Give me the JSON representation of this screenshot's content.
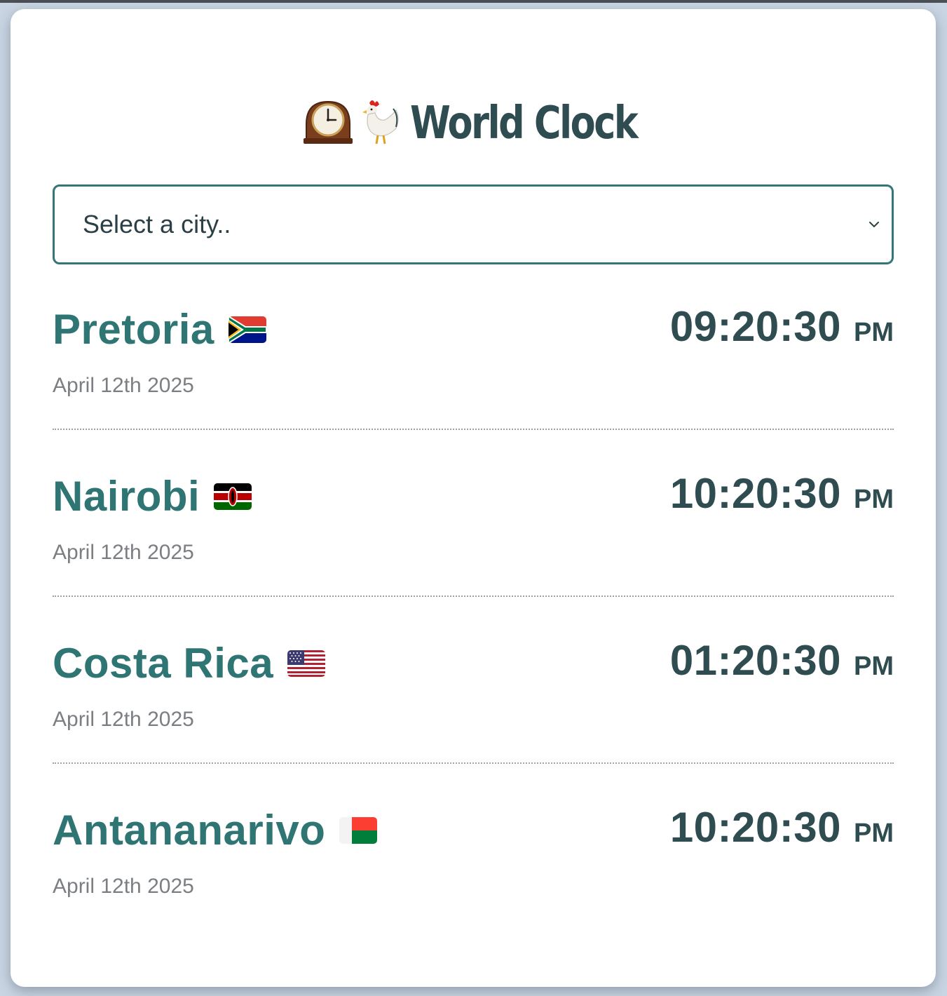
{
  "app": {
    "title": "World Clock",
    "title_icons": [
      "mantelpiece-clock-icon",
      "rooster-icon"
    ]
  },
  "selector": {
    "placeholder": "Select a city..",
    "icon": "chevron-down-icon"
  },
  "colors": {
    "accent": "#33757a",
    "city_name": "#2f7574",
    "time": "#2f4c51",
    "date": "#7b7f83",
    "background": "#c9d5e2"
  },
  "cities": [
    {
      "name": "Pretoria",
      "flag": "south-africa-flag-icon",
      "date": "April 12th 2025",
      "time": "09:20:30",
      "ampm": "PM"
    },
    {
      "name": "Nairobi",
      "flag": "kenya-flag-icon",
      "date": "April 12th 2025",
      "time": "10:20:30",
      "ampm": "PM"
    },
    {
      "name": "Costa Rica",
      "flag": "united-states-flag-icon",
      "date": "April 12th 2025",
      "time": "01:20:30",
      "ampm": "PM"
    },
    {
      "name": "Antananarivo",
      "flag": "madagascar-flag-icon",
      "date": "April 12th 2025",
      "time": "10:20:30",
      "ampm": "PM"
    }
  ]
}
